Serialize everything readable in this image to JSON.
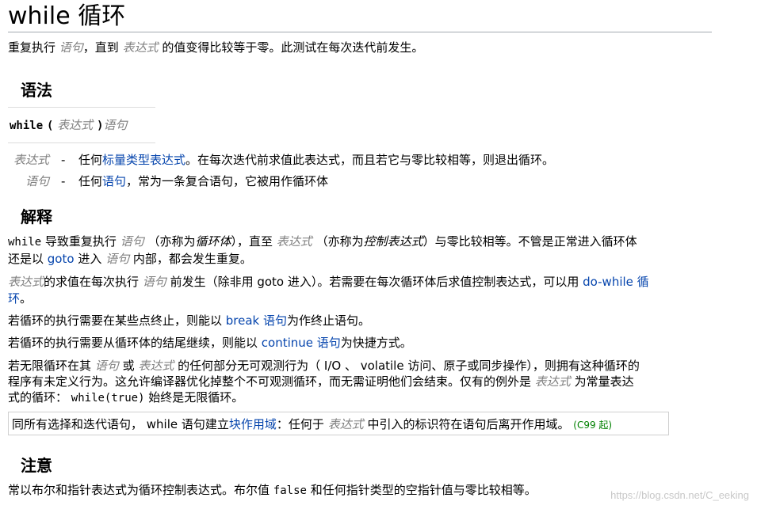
{
  "title": "while 循环",
  "intro": {
    "p1": "重复执行 ",
    "stmt": "语句",
    "p2": "，直到 ",
    "expr": "表达式",
    "p3": " 的值变得比较等于零。此测试在每次迭代前发生。"
  },
  "syntax": {
    "heading": "语法",
    "kw_while": "while",
    "open": "(",
    "expr": "表达式",
    "close": ")",
    "stmt": "语句",
    "params": [
      {
        "name": "表达式",
        "dash": "-",
        "pre": "任何",
        "link": "标量类型表达式",
        "post": "。在每次迭代前求值此表达式，而且若它与零比较相等，则退出循环。"
      },
      {
        "name": "语句",
        "dash": "-",
        "pre": "任何",
        "link": "语句",
        "post": "，常为一条复合语句，它被用作循环体"
      }
    ]
  },
  "explanation": {
    "heading": "解释",
    "p1": {
      "code": "while",
      "t1": " 导致重复执行 ",
      "stmt": "语句",
      "t2": " （亦称为",
      "loop_body": "循环体",
      "t3": "），直至 ",
      "expr": "表达式",
      "t4": " （亦称为",
      "ctrl_expr": "控制表达式",
      "t5": "）与零比较相等。不管是正常进入循环体",
      "t6": "还是以 ",
      "goto": "goto",
      "t7": " 进入 ",
      "stmt2": "语句",
      "t8": " 内部，都会发生重复。"
    },
    "p2": {
      "expr": "表达式",
      "t1": "的求值在每次执行 ",
      "stmt": "语句",
      "t2": " 前发生（除非用 goto 进入）。若需要在每次循环体后求值控制表达式，可以用 ",
      "link1": "do-while 循",
      "link2": "环",
      "t3": "。"
    },
    "p3": {
      "t1": "若循环的执行需要在某些点终止，则能以 ",
      "link": "break 语句",
      "t2": "为作终止语句。"
    },
    "p4": {
      "t1": "若循环的执行需要从循环体的结尾继续，则能以 ",
      "link": "continue 语句",
      "t2": "为快捷方式。"
    },
    "p5": {
      "t1": "若无限循环在其 ",
      "stmt": "语句",
      "t2": " 或 ",
      "expr": "表达式",
      "t3": " 的任何部分无可观测行为（ I/O 、 volatile 访问、原子或同步操作），则拥有这种循环的",
      "t4": "程序有未定义行为。这允许编译器优化掉整个不可观测循环，而无需证明他们会结束。仅有的例外是 ",
      "expr2": "表达式",
      "t5": " 为常量表达",
      "t6": "式的循环： ",
      "code": "while(true)",
      "t7": " 始终是无限循环。"
    },
    "note": {
      "t1": "同所有选择和迭代语句， while 语句建立",
      "link": "块作用域",
      "t2": "：任何于 ",
      "expr": "表达式",
      "t3": " 中引入的标识符在语句后离开作用域。",
      "since": "(C99 起)"
    }
  },
  "notes": {
    "heading": "注意",
    "t1": "常以布尔和指针表达式为循环控制表达式。布尔值 ",
    "code": "false",
    "t2": " 和任何指针类型的空指针值与零比较相等。"
  },
  "watermark": "https://blog.csdn.net/C_eeking",
  "colors": {
    "link": "#0645ad",
    "param": "#808080",
    "since": "#008000"
  }
}
